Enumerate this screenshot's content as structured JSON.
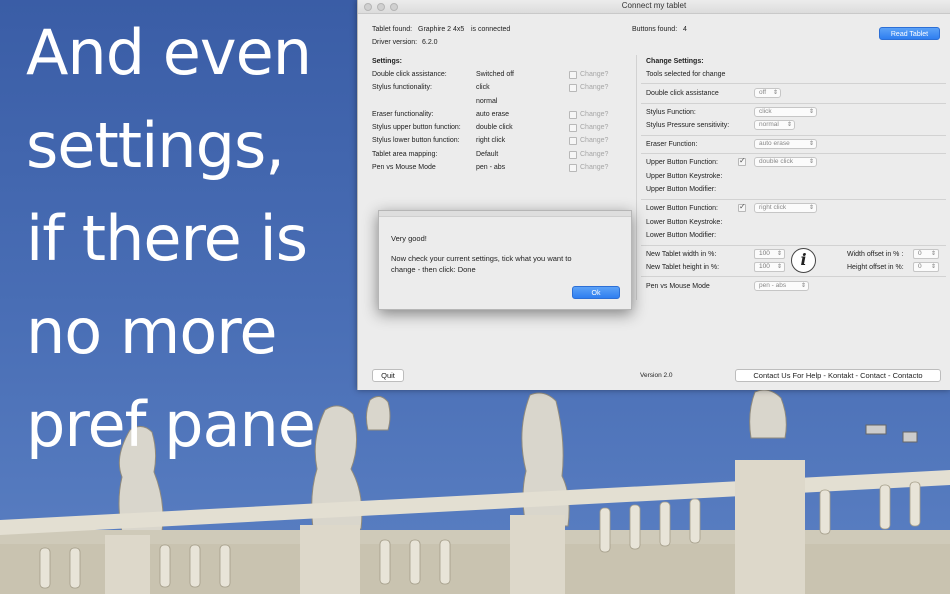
{
  "headline": [
    "And even",
    "settings,",
    "if there is",
    "no more",
    "pref pane"
  ],
  "window": {
    "title": "Connect my tablet",
    "tablet_found_label": "Tablet found:",
    "tablet_name": "Graphire 2 4x5",
    "tablet_status": "is connected",
    "buttons_found_label": "Buttons found:",
    "buttons_found_value": "4",
    "read_tablet_button": "Read Tablet",
    "driver_version_label": "Driver version:",
    "driver_version_value": "6.2.0",
    "settings_heading": "Settings:",
    "change_heading": "Change Settings:",
    "tools_selected": "Tools selected for  change",
    "change_label": "Change?",
    "settings": [
      {
        "label": "Double click assistance:",
        "value": "Switched off"
      },
      {
        "label": "Stylus functionality:",
        "value": "click"
      },
      {
        "label": "",
        "value": "normal"
      },
      {
        "label": "Eraser functionality:",
        "value": "auto erase"
      },
      {
        "label": "Stylus upper button function:",
        "value": "double click"
      },
      {
        "label": "Stylus lower button function:",
        "value": "right click"
      },
      {
        "label": "Tablet area mapping:",
        "value": "Default"
      },
      {
        "label": "Pen vs Mouse Mode",
        "value": "pen - abs"
      }
    ],
    "change": {
      "double_click_label": "Double click assistance",
      "double_click_value": "off",
      "stylus_function_label": "Stylus Function:",
      "stylus_function_value": "click",
      "pressure_label": "Stylus Pressure sensitivity:",
      "pressure_value": "normal",
      "eraser_label": "Eraser Function:",
      "eraser_value": "auto erase",
      "upper_function_label": "Upper Button Function:",
      "upper_function_value": "double click",
      "upper_keystroke_label": "Upper Button Keystroke:",
      "upper_modifier_label": "Upper Button Modifier:",
      "lower_function_label": "Lower Button Function:",
      "lower_function_value": "right click",
      "lower_keystroke_label": "Lower Button Keystroke:",
      "lower_modifier_label": "Lower Button Modifier:",
      "width_label": "New Tablet width in %:",
      "width_value": "100",
      "height_label": "New Tablet height in %:",
      "height_value": "100",
      "width_offset_label": "Width offset in % :",
      "width_offset_value": "0",
      "height_offset_label": "Height offset in %:",
      "height_offset_value": "0",
      "pen_mode_label": "Pen vs Mouse Mode",
      "pen_mode_value": "pen - abs",
      "info_glyph": "i"
    },
    "quit_button": "Quit",
    "version": "Version 2.0",
    "contact_button": "Contact Us For Help - Kontakt - Contact - Contacto"
  },
  "dialog": {
    "title": "Very good!",
    "message_line1": "Now check your current settings, tick what you want to",
    "message_line2": "change - then click: Done",
    "ok_button": "Ok"
  },
  "colors": {
    "sky": "#3f63a8",
    "accent": "#2f7ef0",
    "window_bg": "#ececec"
  }
}
